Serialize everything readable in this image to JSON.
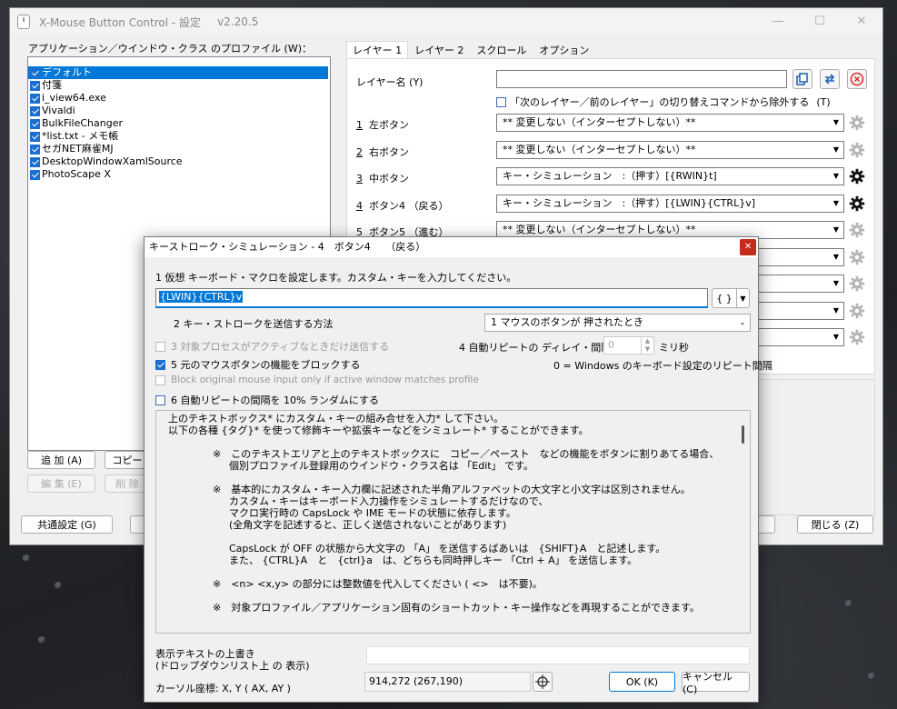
{
  "window": {
    "title": "X-Mouse Button Control - 設定",
    "version": "v2.20.5"
  },
  "profiles": {
    "label": "アプリケーション／ウインドウ・クラス のプロファイル (W)：",
    "items": [
      {
        "label": "デフォルト",
        "selected": true
      },
      {
        "label": "付箋"
      },
      {
        "label": "i_view64.exe"
      },
      {
        "label": "Vivaldi"
      },
      {
        "label": "BulkFileChanger"
      },
      {
        "label": "*list.txt - メモ帳"
      },
      {
        "label": "セガNET麻雀MJ"
      },
      {
        "label": "DesktopWindowXamlSource"
      },
      {
        "label": "PhotoScape X"
      }
    ],
    "add": "追 加 (A)",
    "copy": "コピー",
    "edit": "編 集 (E)",
    "delete": "削 除"
  },
  "footer": {
    "common": "共通設定 (G)",
    "close": "閉じる (Z)"
  },
  "tabs": [
    "レイヤー 1",
    "レイヤー 2",
    "スクロール",
    "オプション"
  ],
  "layer": {
    "name_label": "レイヤー名 (Y)",
    "exclude_label": "「次のレイヤー／前のレイヤー」の切り替えコマンドから除外する",
    "exclude_key": "(T)",
    "rows": [
      {
        "num": "1",
        "label": "左ボタン",
        "value": "** 変更しない（インターセプトしない）**"
      },
      {
        "num": "2",
        "label": "右ボタン",
        "value": "** 変更しない（インターセプトしない）**"
      },
      {
        "num": "3",
        "label": "中ボタン",
        "value": "キー・シミュレーション　:（押す）[{RWIN}t]"
      },
      {
        "num": "4",
        "label": "ボタン4 （戻る）",
        "value": "キー・シミュレーション　:（押す）[{LWIN}{CTRL}v]"
      },
      {
        "num": "5",
        "label": "ボタン5 （進む）",
        "value": "** 変更しない（インターセプトしない）**"
      }
    ]
  },
  "dialog": {
    "title": "キーストローク・シミュレーション - 4　ボタン4　　（戻る）",
    "step1": "1  仮想 キーボード・マクロを設定します。カスタム・キーを入力してください。",
    "macro": "{LWIN}{CTRL}v",
    "braces": "{ }",
    "step2": "2  キー・ストロークを送信する方法",
    "method": "1  マウスのボタンが 押されたとき",
    "step3": "3  対象プロセスがアクティブなときだけ送信する",
    "step4": "4  自動リピートの ディレイ・間隔",
    "delay": "0",
    "ms": "ミリ秒",
    "step5": "5  元のマウスボタンの機能をブロックする",
    "windows_note": "0 = Windows のキーボード設定のリピート間隔",
    "block_only": "Block original mouse input only if active window matches profile",
    "step6": "6  自動リピートの間隔を 10% ランダムにする",
    "help": [
      "上のテキストボックス* にカスタム・キーの組み合せを入力* して下さい。",
      "以下の各種 {タグ}* を使って修飾キーや拡張キーなどをシミュレート* することができます。",
      "※　このテキストエリアと上のテキストボックスに　コピー／ペースト　などの機能をボタンに割りあてる場合、",
      "個別プロファイル登録用のウインドウ・クラス名は 「Edit」 です。",
      "※　基本的にカスタム・キー入力欄に記述された半角アルファベットの大文字と小文字は区別されません。",
      "カスタム・キーはキーボード入力操作をシミュレートするだけなので、",
      "マクロ実行時の CapsLock や IME モードの状態に依存します。",
      "(全角文字を記述すると、正しく送信されないことがあります)",
      "CapsLock が OFF の状態から大文字の 「A」 を送信するばあいは　{SHIFT}A　と記述します。",
      "また、 {CTRL}A　と　{ctrl}a　は、どちらも同時押しキー 「Ctrl + A」 を送信します。",
      "※　<n> <x,y> の部分には整数値を代入してください ( <>　は不要)。",
      "※　対象プロファイル／アプリケーション固有のショートカット・キー操作などを再現することができます。"
    ],
    "override_label1": "表示テキストの上書き",
    "override_label2": "(ドロップダウンリスト上 の 表示)",
    "cursor_label": "カーソル座標:  X, Y  ( AX, AY )",
    "cursor_value": "914,272 (267,190)",
    "ok": "OK  (K)",
    "cancel": "キャンセル (C)"
  }
}
